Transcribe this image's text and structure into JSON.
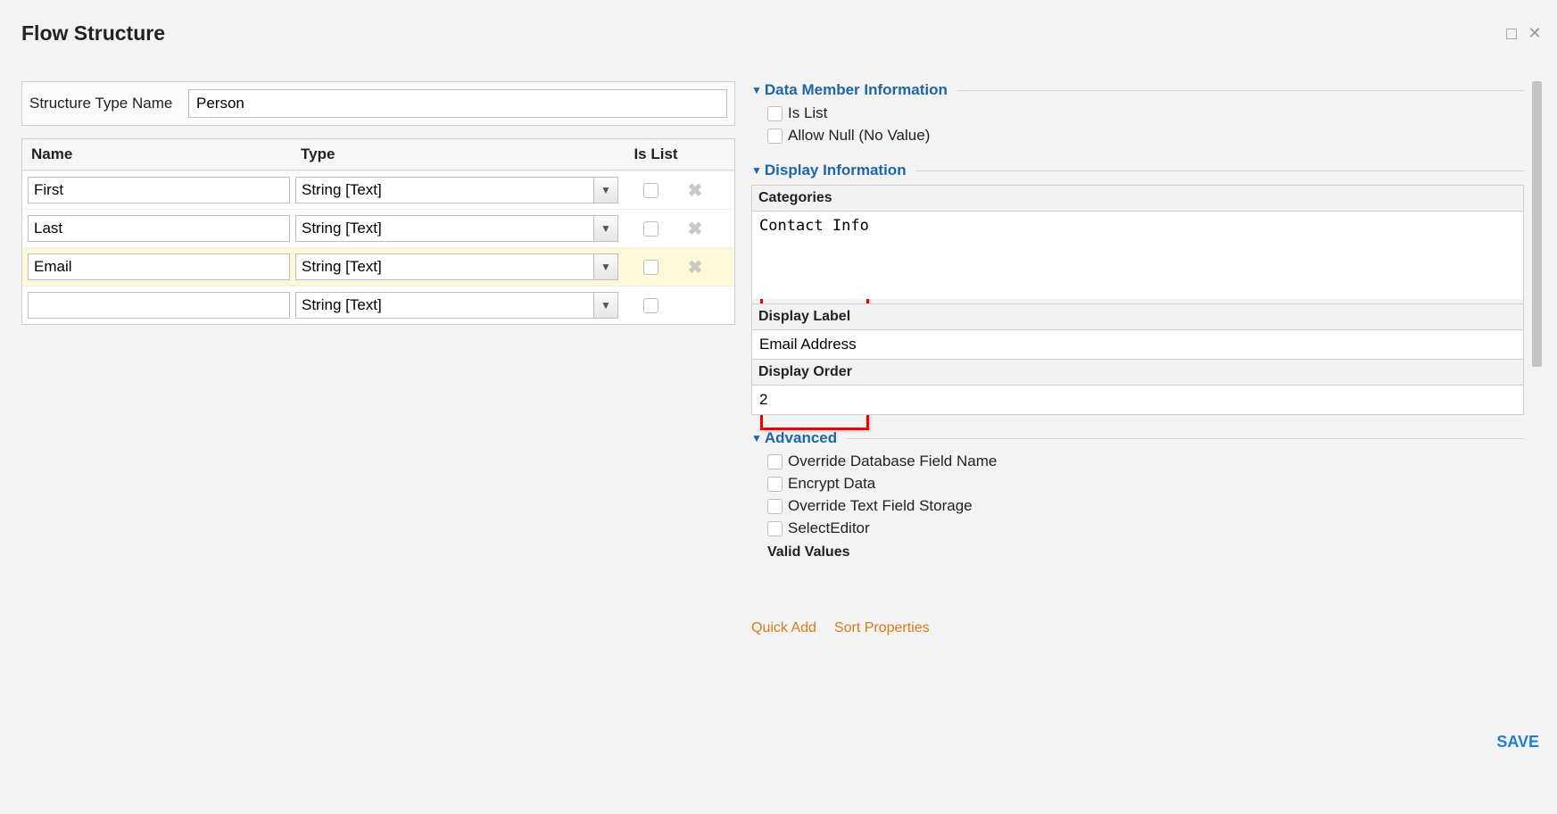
{
  "dialog": {
    "title": "Flow Structure",
    "structure_type_label": "Structure Type Name",
    "structure_type_value": "Person",
    "save_label": "SAVE"
  },
  "grid": {
    "head_name": "Name",
    "head_type": "Type",
    "head_islist": "Is List",
    "rows": [
      {
        "name": "First",
        "type": "String [Text]",
        "is_list": false,
        "deletable": true
      },
      {
        "name": "Last",
        "type": "String [Text]",
        "is_list": false,
        "deletable": true
      },
      {
        "name": "Email",
        "type": "String [Text]",
        "is_list": false,
        "deletable": true,
        "highlight": true
      },
      {
        "name": "",
        "type": "String [Text]",
        "is_list": false,
        "deletable": false
      }
    ]
  },
  "rightPanel": {
    "section_member": "Data Member Information",
    "chk_islist": "Is List",
    "chk_allow_null": "Allow Null (No Value)",
    "section_display": "Display Information",
    "categories_label": "Categories",
    "categories_value": "Contact Info",
    "display_label_label": "Display Label",
    "display_label_value": "Email Address",
    "display_order_label": "Display Order",
    "display_order_value": "2",
    "section_advanced": "Advanced",
    "chk_override_db": "Override Database Field Name",
    "chk_encrypt": "Encrypt Data",
    "chk_override_text": "Override Text Field Storage",
    "chk_select_editor": "SelectEditor",
    "valid_values": "Valid Values",
    "quick_add": "Quick Add",
    "sort_props": "Sort Properties"
  }
}
